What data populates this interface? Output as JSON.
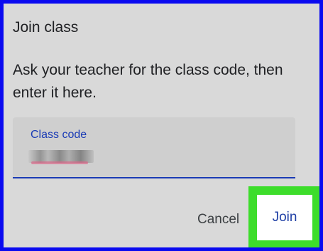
{
  "dialog": {
    "title": "Join class",
    "instructions": "Ask your teacher for the class code, then enter it here.",
    "field": {
      "label": "Class code",
      "value_obscured": true
    },
    "actions": {
      "cancel_label": "Cancel",
      "join_label": "Join"
    }
  },
  "colors": {
    "frame_border": "#0a0af0",
    "highlight": "#3ddd2b",
    "accent": "#1a3bb5",
    "background": "#d9d9d9"
  }
}
